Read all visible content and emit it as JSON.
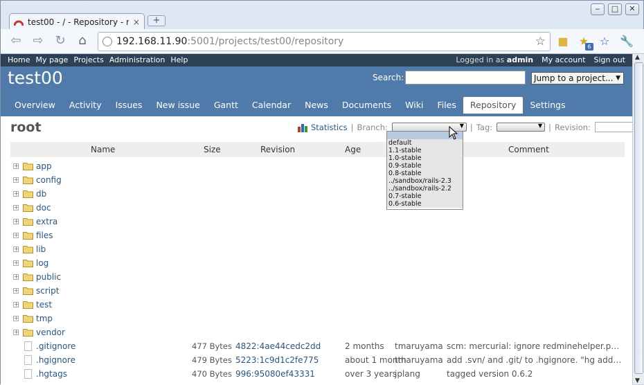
{
  "browser": {
    "tab_title": "test00 - / - Repository - r...",
    "tab_close": "×",
    "new_tab": "+",
    "url_host": "192.168.11.90",
    "url_path": ":5001/projects/test00/repository",
    "ext_badge": "6"
  },
  "top_menu": {
    "left": [
      "Home",
      "My page",
      "Projects",
      "Administration",
      "Help"
    ],
    "logged_in_label": "Logged in as",
    "user": "admin",
    "my_account": "My account",
    "sign_out": "Sign out"
  },
  "header": {
    "project": "test00",
    "search_label": "Search:",
    "jump_label": "Jump to a project...",
    "menu": [
      "Overview",
      "Activity",
      "Issues",
      "New issue",
      "Gantt",
      "Calendar",
      "News",
      "Documents",
      "Wiki",
      "Files",
      "Repository",
      "Settings"
    ],
    "selected": "Repository"
  },
  "content": {
    "title": "root",
    "statistics": "Statistics",
    "sep": "|",
    "branch_label": "Branch:",
    "tag_label": "Tag:",
    "revision_label": "Revision:"
  },
  "columns": [
    "Name",
    "Size",
    "Revision",
    "Age",
    "Comment"
  ],
  "dirs": [
    "app",
    "config",
    "db",
    "doc",
    "extra",
    "files",
    "lib",
    "log",
    "public",
    "script",
    "test",
    "tmp",
    "vendor"
  ],
  "files": [
    {
      "name": ".gitignore",
      "size": "477 Bytes",
      "rev": "4822:4ae44cedc2dd",
      "age": "2 months",
      "author": "tmaruyama",
      "comment": "scm: mercurial: ignore redminehelper.pyc and re..."
    },
    {
      "name": ".hgignore",
      "size": "479 Bytes",
      "rev": "5223:1c9d1c2fe775",
      "age": "about 1 month",
      "author": "tmaruyama",
      "comment": "add .svn/ and .git/ to .hgignore. \"hg addremov..."
    },
    {
      "name": ".hgtags",
      "size": "470 Bytes",
      "rev": "996:95080ef43331",
      "age": "over 3 years",
      "author": "jplang",
      "comment": "tagged version 0.6.2"
    }
  ],
  "branch_options": [
    "",
    "default",
    "1.1-stable",
    "1.0-stable",
    "0.9-stable",
    "0.8-stable",
    "../sandbox/rails-2.3",
    "../sandbox/rails-2.2",
    "0.7-stable",
    "0.6-stable"
  ],
  "colors": {
    "header": "#507aaa",
    "top_menu": "#2c4056",
    "link": "#2a5685"
  }
}
